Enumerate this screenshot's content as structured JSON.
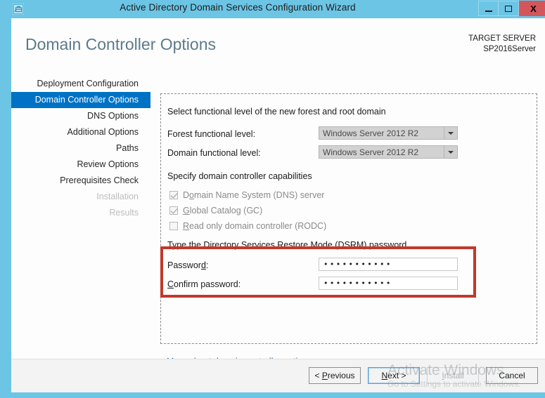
{
  "window": {
    "title": "Active Directory Domain Services Configuration Wizard",
    "icon": "server-config-icon",
    "minimize_label": "Minimize",
    "maximize_label": "Maximize",
    "close_label": "X"
  },
  "header": {
    "page_title": "Domain Controller Options",
    "target_server_caption": "TARGET SERVER",
    "target_server_name": "SP2016Server"
  },
  "sidebar": {
    "items": [
      {
        "label": "Deployment Configuration",
        "state": "normal"
      },
      {
        "label": "Domain Controller Options",
        "state": "selected"
      },
      {
        "label": "DNS Options",
        "state": "normal"
      },
      {
        "label": "Additional Options",
        "state": "normal"
      },
      {
        "label": "Paths",
        "state": "normal"
      },
      {
        "label": "Review Options",
        "state": "normal"
      },
      {
        "label": "Prerequisites Check",
        "state": "normal"
      },
      {
        "label": "Installation",
        "state": "disabled"
      },
      {
        "label": "Results",
        "state": "disabled"
      }
    ]
  },
  "main": {
    "functional_level_heading": "Select functional level of the new forest and root domain",
    "forest_level_label": "Forest functional level:",
    "forest_level_value": "Windows Server 2012 R2",
    "domain_level_label": "Domain functional level:",
    "domain_level_value": "Windows Server 2012 R2",
    "capabilities_heading": "Specify domain controller capabilities",
    "checkboxes": [
      {
        "label_pre": "D",
        "label_accel": "o",
        "label_post": "main Name System (DNS) server",
        "checked": true,
        "enabled": false
      },
      {
        "label_pre": "",
        "label_accel": "G",
        "label_post": "lobal Catalog (GC)",
        "checked": true,
        "enabled": false
      },
      {
        "label_pre": "",
        "label_accel": "R",
        "label_post": "ead only domain controller (RODC)",
        "checked": false,
        "enabled": false
      }
    ],
    "dsrm_heading": "Type the Directory Services Restore Mode (DSRM) password",
    "password_label_pre": "Passwor",
    "password_label_accel": "d",
    "password_label_post": ":",
    "password_value": "•••••••••••",
    "confirm_label_accel": "C",
    "confirm_label_post": "onfirm password:",
    "confirm_value": "•••••••••••",
    "more_link": "More about domain controller options"
  },
  "footer": {
    "previous_label": "< Previous",
    "next_label": "Next >",
    "install_label": "Install",
    "cancel_label": "Cancel"
  },
  "watermark": {
    "line1": "Activate Windows",
    "line2": "Go to Settings to activate Windows."
  },
  "colors": {
    "accent": "#6cc5e5",
    "selection": "#0072c6",
    "annotation": "#c0392b",
    "close_button": "#d4565a",
    "link": "#2b6b9e"
  }
}
